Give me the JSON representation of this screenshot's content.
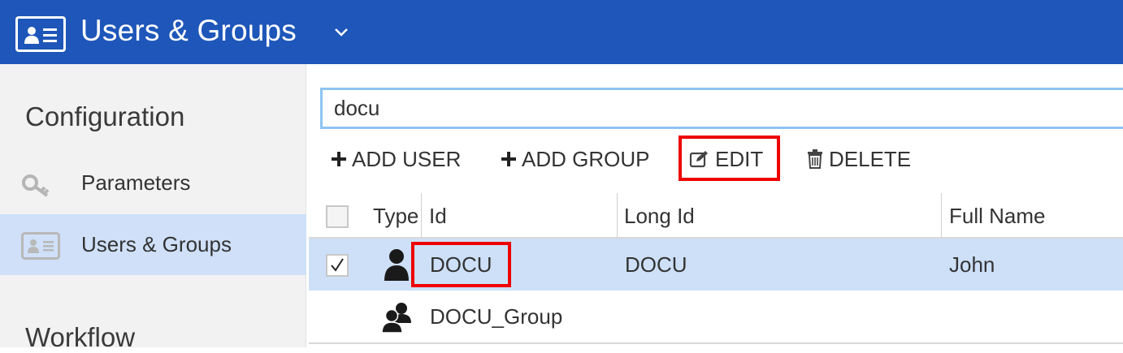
{
  "header": {
    "title": "Users & Groups"
  },
  "sidebar": {
    "sections": [
      {
        "heading": "Configuration"
      },
      {
        "heading": "Workflow"
      }
    ],
    "items": [
      {
        "label": "Parameters",
        "icon": "key-icon"
      },
      {
        "label": "Users & Groups",
        "icon": "id-card-icon",
        "active": true
      }
    ]
  },
  "search": {
    "value": "docu"
  },
  "toolbar": {
    "add_user": "ADD USER",
    "add_group": "ADD GROUP",
    "edit": "EDIT",
    "delete": "DELETE"
  },
  "table": {
    "columns": [
      "Type",
      "Id",
      "Long Id",
      "Full Name"
    ],
    "rows": [
      {
        "selected": true,
        "type": "user-icon",
        "id": "DOCU",
        "long_id": "DOCU",
        "full_name": "John"
      },
      {
        "selected": false,
        "type": "group-icon",
        "id": "DOCU_Group",
        "long_id": "",
        "full_name": ""
      }
    ]
  },
  "colors": {
    "header": "#1e56b9",
    "selection": "#cde0f8",
    "highlight": "#ee0000"
  }
}
